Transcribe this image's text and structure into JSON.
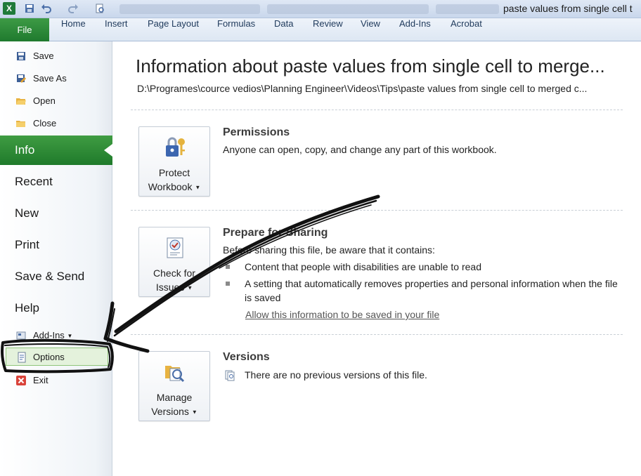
{
  "titlebar": {
    "window_title": "paste values from single cell t"
  },
  "ribbon": {
    "file_tab": "File",
    "tabs": [
      "Home",
      "Insert",
      "Page Layout",
      "Formulas",
      "Data",
      "Review",
      "View",
      "Add-Ins",
      "Acrobat"
    ]
  },
  "nav": {
    "save": "Save",
    "save_as": "Save As",
    "open": "Open",
    "close": "Close",
    "info": "Info",
    "recent": "Recent",
    "new": "New",
    "print": "Print",
    "save_send": "Save & Send",
    "help": "Help",
    "add_ins": "Add-Ins",
    "options": "Options",
    "exit": "Exit"
  },
  "info": {
    "title": "Information about paste values from single cell to merge...",
    "path": "D:\\Programes\\cource vedios\\Planning Engineer\\Videos\\Tips\\paste values from single cell to merged c...",
    "permissions": {
      "button_line1": "Protect",
      "button_line2": "Workbook",
      "title": "Permissions",
      "text": "Anyone can open, copy, and change any part of this workbook."
    },
    "sharing": {
      "button_line1": "Check for",
      "button_line2": "Issues",
      "title": "Prepare for Sharing",
      "intro": "Before sharing this file, be aware that it contains:",
      "items": [
        "Content that people with disabilities are unable to read",
        "A setting that automatically removes properties and personal information when the file is saved"
      ],
      "link": "Allow this information to be saved in your file"
    },
    "versions": {
      "button_line1": "Manage",
      "button_line2": "Versions",
      "title": "Versions",
      "text": "There are no previous versions of this file."
    }
  },
  "colors": {
    "accent_green": "#1f7a2b",
    "ribbon_blue": "#dde7f3"
  }
}
